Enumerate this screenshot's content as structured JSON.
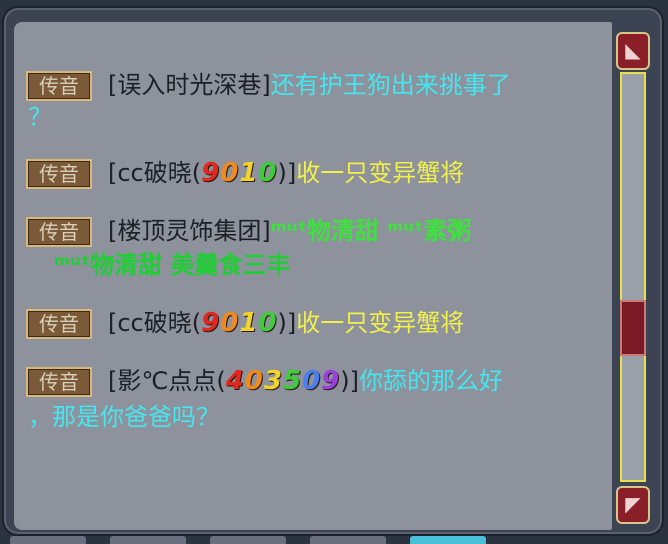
{
  "channel_label": "传音",
  "messages": [
    {
      "sender": "[误入时光深巷]",
      "text": "还有护王狗出来挑事了",
      "text2": "？"
    },
    {
      "sender_open": "[cc破晓(",
      "achievement": "9010",
      "sender_close": ")]",
      "text": "收一只变异蟹将"
    },
    {
      "sender": "[楼顶灵饰集团]",
      "text": "ᵐᵘᵗ物清甜   ᵐᵘᵗ素粥",
      "text2": "ᵐᵘᵗ物清甜   美羹食三丰"
    },
    {
      "sender_open": "[cc破晓(",
      "achievement": "9010",
      "sender_close": ")]",
      "text": "收一只变异蟹将"
    },
    {
      "sender_open": "[影℃点点(",
      "achievement": "403509",
      "sender_close": ")]",
      "text": "你舔的那么好",
      "text2": "，那是你爸爸吗？"
    }
  ],
  "achievement_colors": [
    "#e0281e",
    "#f08a1e",
    "#f2d42a",
    "#3fcc3a",
    "#4a7ef0",
    "#9a3fe0"
  ],
  "colors": {
    "text_cyan": "#45e6f0",
    "text_yellow": "#f2f04a",
    "text_green": "#3fe040",
    "scrollbar_accent": "#e8df49"
  },
  "icons": {
    "scroll_up": "scroll-up-icon",
    "scroll_down": "scroll-down-icon"
  }
}
